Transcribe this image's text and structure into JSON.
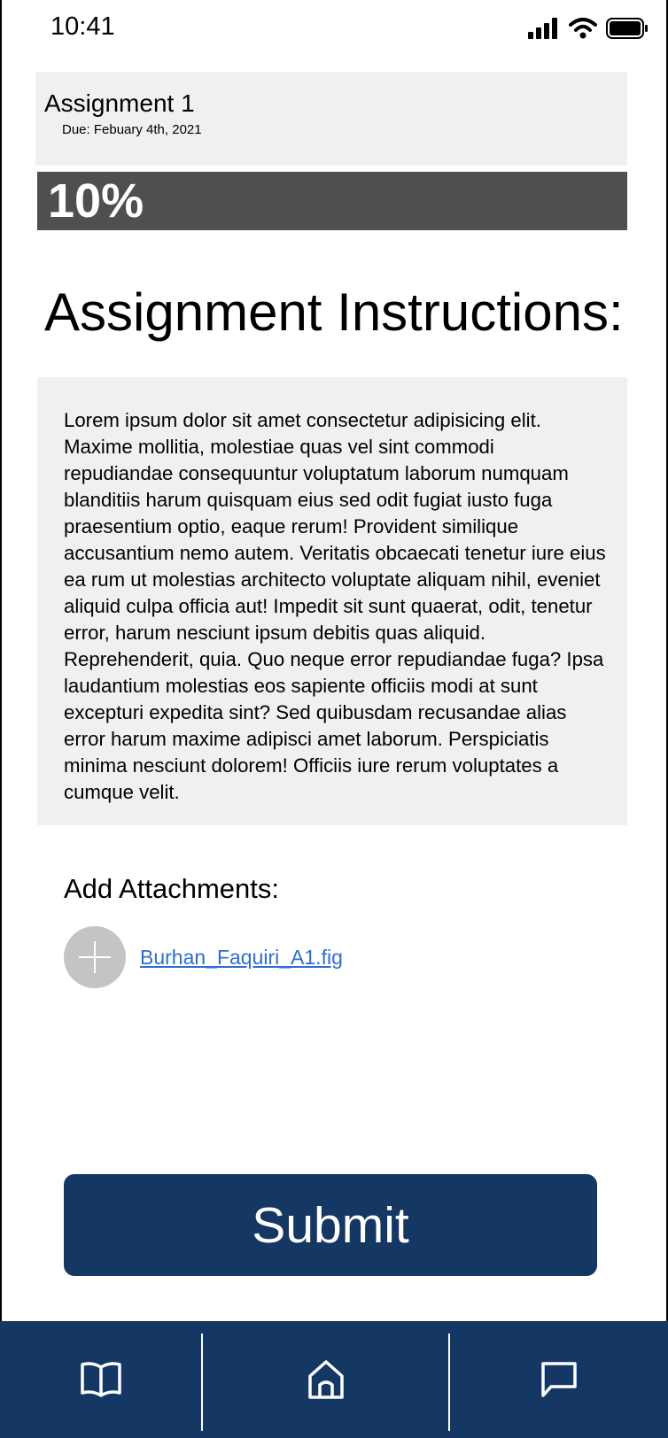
{
  "status_bar": {
    "time": "10:41",
    "icons": [
      "signal-icon",
      "wifi-icon",
      "battery-icon"
    ]
  },
  "assignment": {
    "title": "Assignment 1",
    "due": "Due: Febuary 4th, 2021"
  },
  "progress": {
    "label": "10%",
    "value": 10
  },
  "instructions": {
    "title": "Assignment Instructions:",
    "body": "Lorem ipsum dolor sit amet consectetur adipisicing elit. Maxime mollitia, molestiae quas vel sint commodi repudiandae consequuntur voluptatum laborum numquam blanditiis harum quisquam eius sed odit fugiat iusto fuga praesentium optio, eaque rerum! Provident similique accusantium nemo autem. Veritatis obcaecati tenetur iure eius ea rum ut molestias architecto voluptate aliquam nihil, eveniet aliquid culpa officia aut! Impedit sit sunt quaerat, odit, tenetur error, harum nesciunt ipsum debitis quas aliquid. Reprehenderit, quia. Quo neque error repudiandae fuga? Ipsa laudantium molestias eos  sapiente officiis modi at sunt excepturi expedita sint? Sed quibusdam recusandae alias error harum maxime adipisci amet laborum. Perspiciatis  minima nesciunt dolorem! Officiis iure rerum voluptates a cumque velit."
  },
  "attachments": {
    "title": "Add Attachments:",
    "add_icon": "plus-icon",
    "file": "Burhan_Faquiri_A1.fig"
  },
  "submit": {
    "label": "Submit"
  },
  "bottom_nav": {
    "items": [
      {
        "icon": "book-icon"
      },
      {
        "icon": "home-icon"
      },
      {
        "icon": "chat-icon"
      }
    ]
  },
  "colors": {
    "primary": "#143764",
    "card": "#f0f0f0",
    "progress": "#4f4f4f",
    "link": "#2f6ed1",
    "attach_button": "#c4c4c4"
  }
}
